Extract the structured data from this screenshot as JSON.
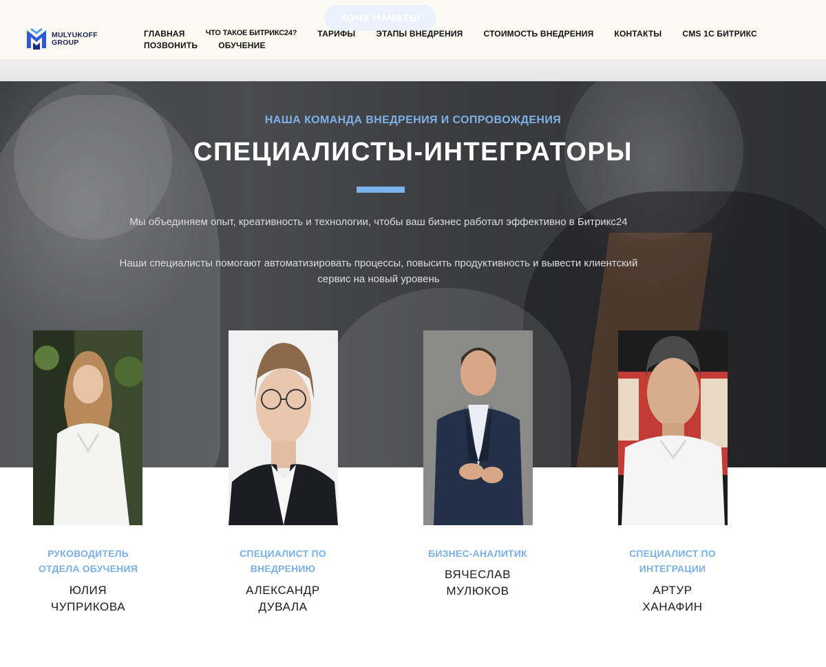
{
  "header": {
    "cta_label": "ХОЧУ НАЧАТЬ!",
    "logo": {
      "line1": "MULYUKOFF",
      "line2": "GROUP"
    },
    "nav_row1": [
      "ГЛАВНАЯ",
      "ЧТО ТАКОЕ БИТРИКС24?",
      "ТАРИФЫ",
      "ЭТАПЫ ВНЕДРЕНИЯ",
      "СТОИМОСТЬ ВНЕДРЕНИЯ",
      "КОНТАКТЫ",
      "CMS 1С БИТРИКС"
    ],
    "nav_row2": [
      "ПОЗВОНИТЬ",
      "ОБУЧЕНИЕ"
    ]
  },
  "hero": {
    "kicker": "НАША КОМАНДА ВНЕДРЕНИЯ И СОПРОВОЖДЕНИЯ",
    "title": "СПЕЦИАЛИСТЫ-ИНТЕГРАТОРЫ",
    "paragraph1": "Мы объединяем опыт, креативность и технологии, чтобы ваш бизнес работал эффективно в Битрикс24",
    "paragraph2": "Наши специалисты помогают автоматизировать процессы, повысить продуктивность и вывести клиентский сервис на новый уровень"
  },
  "team": [
    {
      "role_lines": [
        "РУКОВОДИТЕЛЬ",
        "ОТДЕЛА ОБУЧЕНИЯ"
      ],
      "name_lines": [
        "ЮЛИЯ",
        "ЧУПРИКОВА"
      ]
    },
    {
      "role_lines": [
        "СПЕЦИАЛИСТ ПО",
        "ВНЕДРЕНИЮ"
      ],
      "name_lines": [
        "АЛЕКСАНДР",
        "ДУВАЛА"
      ]
    },
    {
      "role_lines": [
        "БИЗНЕС-АНАЛИТИК"
      ],
      "name_lines": [
        "ВЯЧЕСЛАВ",
        "МУЛЮКОВ"
      ]
    },
    {
      "role_lines": [
        "СПЕЦИАЛИСТ ПО",
        "ИНТЕГРАЦИИ"
      ],
      "name_lines": [
        "АРТУР",
        "ХАНАФИН"
      ]
    }
  ],
  "colors": {
    "accent": "#7ab0e5",
    "header_bg": "#fbfbf1",
    "logo_navy": "#1b2255"
  }
}
